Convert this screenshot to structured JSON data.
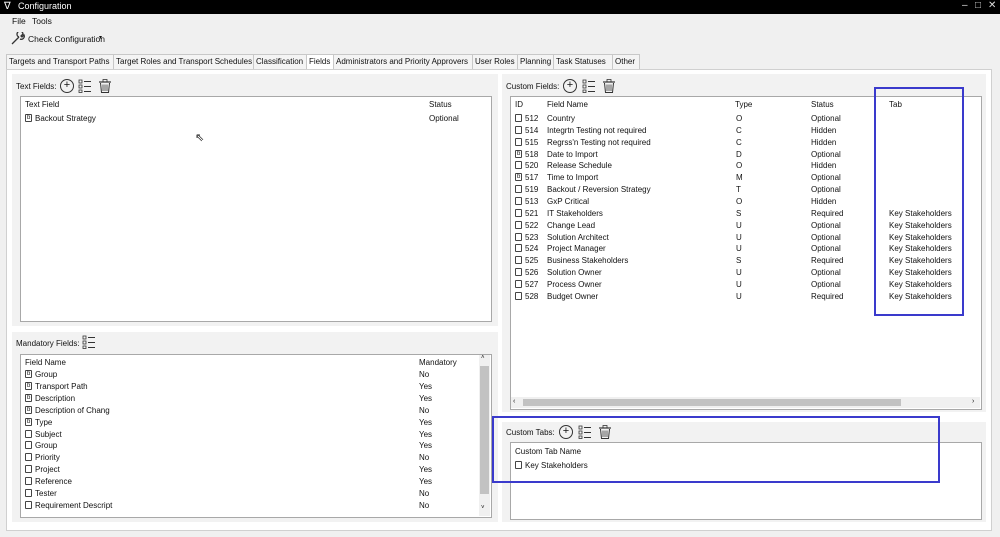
{
  "window": {
    "title": "Configuration",
    "logo": "∇",
    "controls": [
      "–",
      "□",
      "✕"
    ]
  },
  "menu": [
    "File",
    "Tools"
  ],
  "toolbar": {
    "check_label": "Check Configuration"
  },
  "tabs": [
    "Targets and Transport Paths",
    "Target Roles and Transport Schedules",
    "Classification",
    "Fields",
    "Administrators and Priority Approvers",
    "User Roles",
    "Planning",
    "Task Statuses",
    "Other"
  ],
  "active_tab": "Fields",
  "text_fields": {
    "label": "Text Fields:",
    "headers": [
      "Text Field",
      "Status"
    ],
    "rows": [
      {
        "name": "Backout Strategy",
        "status": "Optional"
      }
    ]
  },
  "mandatory_fields": {
    "label": "Mandatory Fields:",
    "headers": [
      "Field Name",
      "Mandatory"
    ],
    "rows": [
      {
        "name": "Group",
        "value": "No",
        "icon": "b"
      },
      {
        "name": "Transport Path",
        "value": "Yes",
        "icon": "b"
      },
      {
        "name": "Description",
        "value": "Yes",
        "icon": "b"
      },
      {
        "name": "Description of Chang",
        "value": "No",
        "icon": "b"
      },
      {
        "name": "Type",
        "value": "Yes",
        "icon": "b"
      },
      {
        "name": "Subject",
        "value": "Yes",
        "icon": ""
      },
      {
        "name": "Group",
        "value": "Yes",
        "icon": ""
      },
      {
        "name": "Priority",
        "value": "No",
        "icon": ""
      },
      {
        "name": "Project",
        "value": "Yes",
        "icon": ""
      },
      {
        "name": "Reference",
        "value": "Yes",
        "icon": ""
      },
      {
        "name": "Tester",
        "value": "No",
        "icon": ""
      },
      {
        "name": "Requirement Descript",
        "value": "No",
        "icon": ""
      }
    ]
  },
  "custom_fields": {
    "label": "Custom Fields:",
    "headers": [
      "ID",
      "Field Name",
      "Type",
      "Status",
      "Tab"
    ],
    "rows": [
      {
        "id": "512",
        "name": "Country",
        "type": "O",
        "status": "Optional",
        "tab": "",
        "icon": ""
      },
      {
        "id": "514",
        "name": "Integrtn Testing not required",
        "type": "C",
        "status": "Hidden",
        "tab": "",
        "icon": ""
      },
      {
        "id": "515",
        "name": "Regrss'n Testing not required",
        "type": "C",
        "status": "Hidden",
        "tab": "",
        "icon": ""
      },
      {
        "id": "518",
        "name": "Date to Import",
        "type": "D",
        "status": "Optional",
        "tab": "",
        "icon": "b"
      },
      {
        "id": "520",
        "name": "Release Schedule",
        "type": "O",
        "status": "Hidden",
        "tab": "",
        "icon": ""
      },
      {
        "id": "517",
        "name": "Time to Import",
        "type": "M",
        "status": "Optional",
        "tab": "",
        "icon": "b"
      },
      {
        "id": "519",
        "name": "Backout / Reversion Strategy",
        "type": "T",
        "status": "Optional",
        "tab": "",
        "icon": ""
      },
      {
        "id": "513",
        "name": "GxP Critical",
        "type": "O",
        "status": "Hidden",
        "tab": "",
        "icon": ""
      },
      {
        "id": "521",
        "name": "IT Stakeholders",
        "type": "S",
        "status": "Required",
        "tab": "Key Stakeholders",
        "icon": ""
      },
      {
        "id": "522",
        "name": "Change Lead",
        "type": "U",
        "status": "Optional",
        "tab": "Key Stakeholders",
        "icon": ""
      },
      {
        "id": "523",
        "name": "Solution Architect",
        "type": "U",
        "status": "Optional",
        "tab": "Key Stakeholders",
        "icon": ""
      },
      {
        "id": "524",
        "name": "Project Manager",
        "type": "U",
        "status": "Optional",
        "tab": "Key Stakeholders",
        "icon": ""
      },
      {
        "id": "525",
        "name": "Business Stakeholders",
        "type": "S",
        "status": "Required",
        "tab": "Key Stakeholders",
        "icon": ""
      },
      {
        "id": "526",
        "name": "Solution Owner",
        "type": "U",
        "status": "Optional",
        "tab": "Key Stakeholders",
        "icon": ""
      },
      {
        "id": "527",
        "name": "Process Owner",
        "type": "U",
        "status": "Optional",
        "tab": "Key Stakeholders",
        "icon": ""
      },
      {
        "id": "528",
        "name": "Budget Owner",
        "type": "U",
        "status": "Required",
        "tab": "Key Stakeholders",
        "icon": ""
      }
    ]
  },
  "custom_tabs": {
    "label": "Custom Tabs:",
    "headers": [
      "Custom Tab Name"
    ],
    "rows": [
      {
        "name": "Key Stakeholders"
      }
    ]
  },
  "colors": {
    "highlight": "#3a3acc",
    "title_bg": "#000000"
  }
}
